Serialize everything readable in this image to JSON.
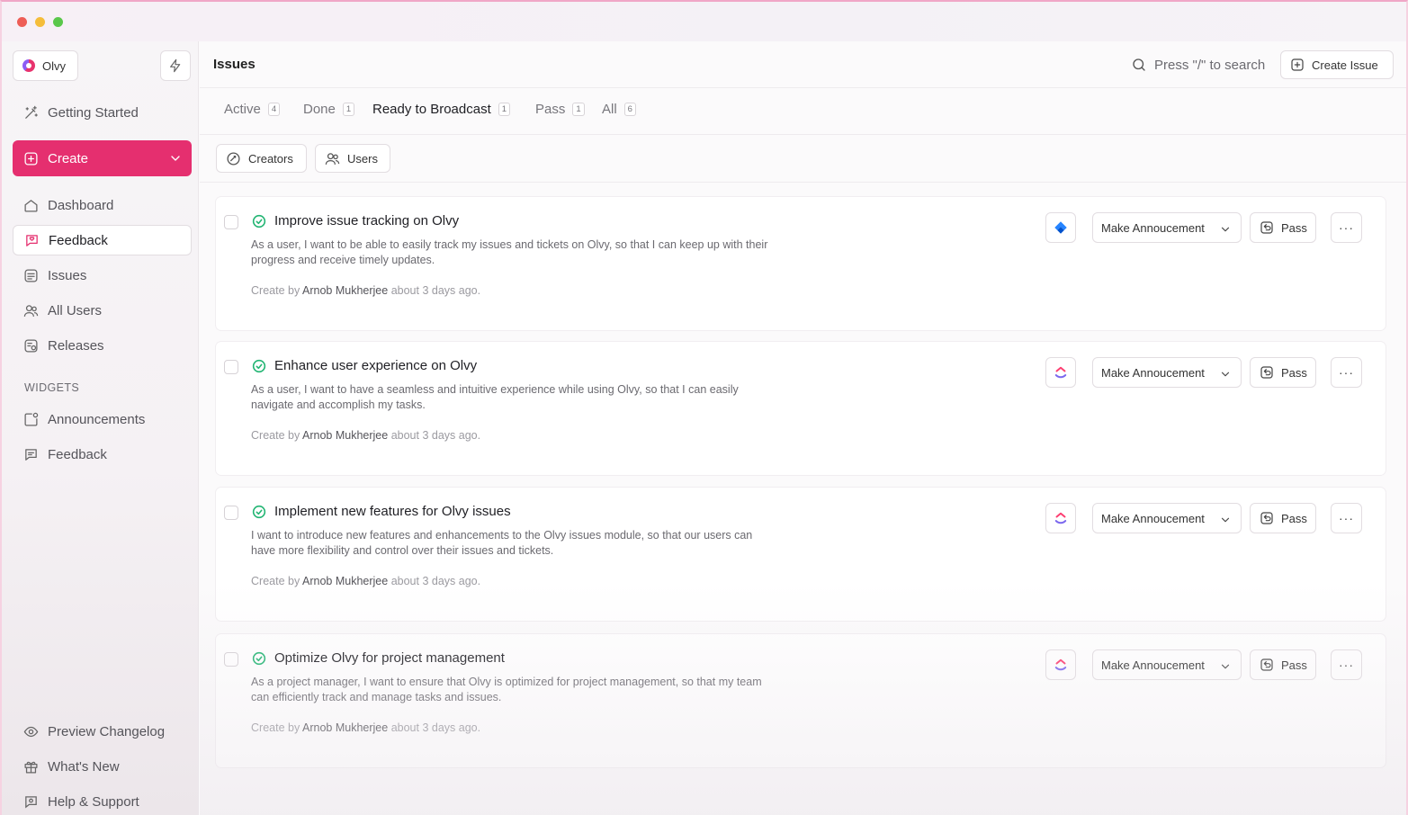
{
  "workspace": {
    "name": "Olvy"
  },
  "sidebar": {
    "getting_started": "Getting Started",
    "create": "Create",
    "items": [
      {
        "label": "Dashboard"
      },
      {
        "label": "Feedback"
      },
      {
        "label": "Issues"
      },
      {
        "label": "All Users"
      },
      {
        "label": "Releases"
      }
    ],
    "widgets_label": "WIDGETS",
    "widgets": [
      {
        "label": "Announcements"
      },
      {
        "label": "Feedback"
      }
    ],
    "footer": [
      {
        "label": "Preview Changelog"
      },
      {
        "label": "What's New"
      },
      {
        "label": "Help & Support"
      }
    ]
  },
  "header": {
    "title": "Issues",
    "search_text": "Press \"/\" to search",
    "create_issue": "Create Issue"
  },
  "tabs": [
    {
      "label": "Active",
      "count": "4"
    },
    {
      "label": "Done",
      "count": "1"
    },
    {
      "label": "Ready to Broadcast",
      "count": "1"
    },
    {
      "label": "Pass",
      "count": "1"
    },
    {
      "label": "All",
      "count": "6"
    }
  ],
  "filters": {
    "creators": "Creators",
    "users": "Users"
  },
  "issues": [
    {
      "title": "Improve issue tracking on Olvy",
      "description": "As a user, I want to be able to easily track my issues and tickets on Olvy, so that I can keep up with their progress and receive timely updates.",
      "created_prefix": "Create by",
      "author": "Arnob Mukherjee",
      "time": "about 3 days ago.",
      "integration_icon": "jira-icon",
      "announce_label": "Make Annoucement",
      "pass_label": "Pass",
      "more_label": "···"
    },
    {
      "title": "Enhance user experience on Olvy",
      "description": "As a user, I want to have a seamless and intuitive experience while using Olvy, so that I can easily navigate and accomplish my tasks.",
      "created_prefix": "Create by",
      "author": "Arnob Mukherjee",
      "time": "about 3 days ago.",
      "integration_icon": "clickup-icon",
      "announce_label": "Make Annoucement",
      "pass_label": "Pass",
      "more_label": "···"
    },
    {
      "title": "Implement new features for Olvy issues",
      "description": "I want to introduce new features and enhancements to the Olvy issues module, so that our users can have more flexibility and control over their issues and tickets.",
      "created_prefix": "Create by",
      "author": "Arnob Mukherjee",
      "time": "about 3 days ago.",
      "integration_icon": "clickup-icon",
      "announce_label": "Make Annoucement",
      "pass_label": "Pass",
      "more_label": "···"
    },
    {
      "title": "Optimize Olvy for project management",
      "description": "As a project manager, I want to ensure that Olvy is optimized for project management, so that my team can efficiently track and manage tasks and issues.",
      "created_prefix": "Create by",
      "author": "Arnob Mukherjee",
      "time": "about 3 days ago.",
      "integration_icon": "clickup-icon",
      "announce_label": "Make Annoucement",
      "pass_label": "Pass",
      "more_label": "···"
    }
  ],
  "colors": {
    "accent": "#e52f6f",
    "success": "#22b573",
    "jira": "#2684ff"
  }
}
